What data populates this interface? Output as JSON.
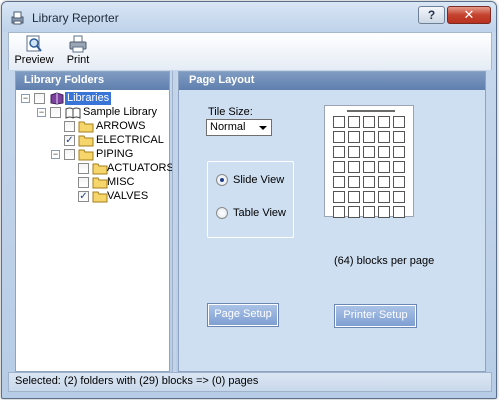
{
  "window": {
    "title": "Library Reporter",
    "help_glyph": "?",
    "close_glyph": "✕"
  },
  "toolbar": {
    "preview_label": "Preview",
    "print_label": "Print"
  },
  "left_panel": {
    "title": "Library Folders",
    "tree": [
      {
        "label": "Libraries",
        "expanded": true,
        "checked": false,
        "icon": "library-book-icon",
        "selected": true
      },
      {
        "label": "Sample Library",
        "expanded": true,
        "checked": false,
        "icon": "open-book-icon",
        "selected": false
      },
      {
        "label": "ARROWS",
        "checked": false,
        "icon": "folder-icon"
      },
      {
        "label": "ELECTRICAL",
        "checked": true,
        "icon": "folder-icon"
      },
      {
        "label": "PIPING",
        "expanded": true,
        "checked": false,
        "icon": "folder-icon"
      },
      {
        "label": "ACTUATORS",
        "checked": false,
        "icon": "folder-icon"
      },
      {
        "label": "MISC",
        "checked": false,
        "icon": "folder-icon"
      },
      {
        "label": "VALVES",
        "checked": true,
        "icon": "folder-icon"
      }
    ],
    "expander_glyph": "−",
    "check_glyph": "✓"
  },
  "right_panel": {
    "title": "Page Layout",
    "tile_size_label": "Tile Size:",
    "tile_size_value": "Normal",
    "views": [
      {
        "label": "Slide View",
        "selected": true
      },
      {
        "label": "Table View",
        "selected": false
      }
    ],
    "blocks_per_page_text": "(64) blocks per page",
    "page_setup_label": "Page Setup",
    "printer_setup_label": "Printer Setup"
  },
  "status": {
    "text": "Selected: (2) folders with (29) blocks => (0) pages"
  },
  "colors": {
    "panel_header": "#6f8dba",
    "selection": "#3875d7",
    "right_panel_bg": "#cfdff2",
    "button": "#8fabd9"
  }
}
